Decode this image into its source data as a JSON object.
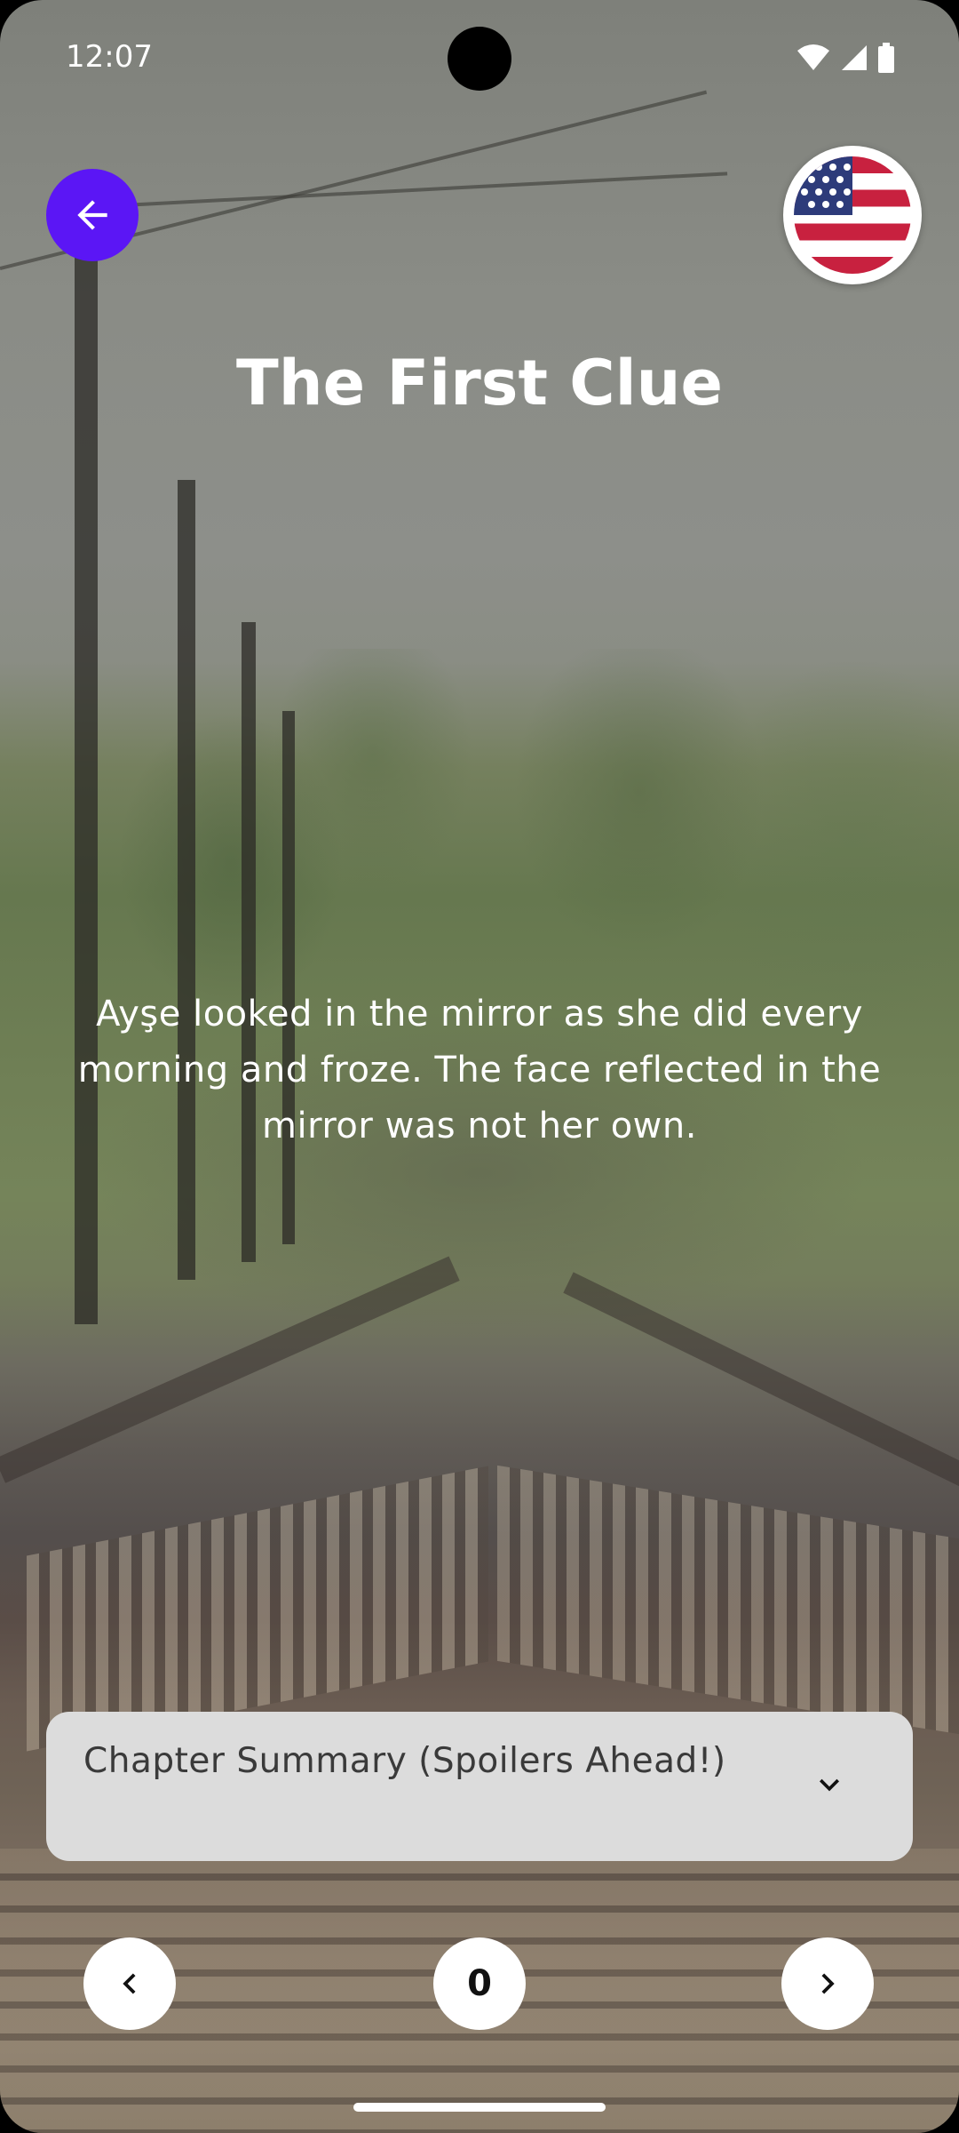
{
  "status_bar": {
    "time": "12:07",
    "icons": [
      "wifi-icon",
      "signal-icon",
      "battery-icon"
    ]
  },
  "header": {
    "back_icon": "arrow-left-icon",
    "language_icon": "us-flag-icon",
    "title": "The First Clue"
  },
  "story": {
    "text": "Ayşe looked in the mirror as she did every morning and froze. The face reflected in the mirror was not her own."
  },
  "summary": {
    "label": "Chapter Summary (Spoilers Ahead!)",
    "icon": "chevron-down-icon"
  },
  "navigation": {
    "prev_icon": "chevron-left-icon",
    "page_number": "0",
    "next_icon": "chevron-right-icon"
  },
  "colors": {
    "accent": "#5b16f5",
    "summary_bg": "#dcdcdc",
    "text_on_image": "#ffffff"
  }
}
